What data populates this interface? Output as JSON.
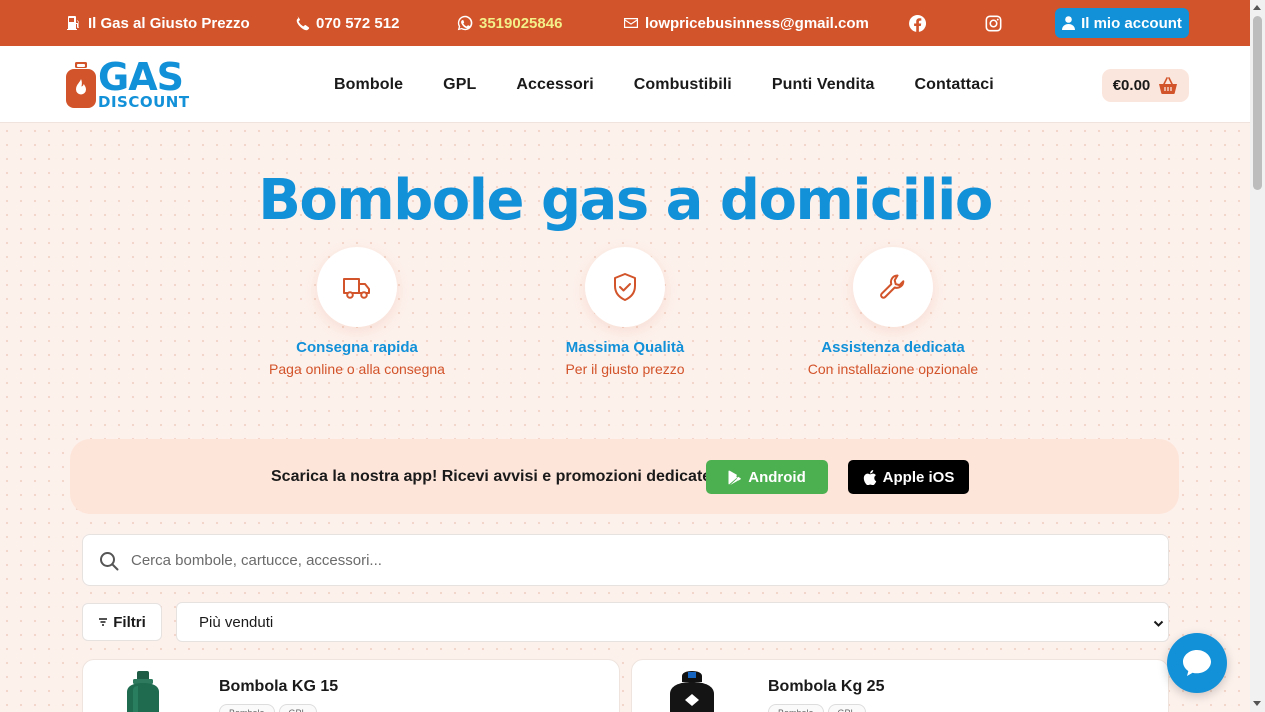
{
  "topbar": {
    "tagline": "Il Gas al Giusto Prezzo",
    "phone": "070 572 512",
    "whatsapp": "3519025846",
    "email": "lowpricebusinness@gmail.com",
    "social_icons": [
      "facebook-icon",
      "instagram-icon"
    ],
    "account_label": "Il mio account"
  },
  "logo": {
    "line1": "GAS",
    "line2": "DISCOUNT"
  },
  "nav": {
    "items": [
      "Bombole",
      "GPL",
      "Accessori",
      "Combustibili",
      "Punti Vendita",
      "Contattaci"
    ]
  },
  "cart": {
    "total": "€0.00"
  },
  "hero": {
    "title": "Bombole gas a domicilio",
    "features": [
      {
        "icon": "truck-icon",
        "title": "Consegna rapida",
        "subtitle": "Paga online o alla consegna"
      },
      {
        "icon": "shield-check-icon",
        "title": "Massima Qualità",
        "subtitle": "Per il giusto prezzo"
      },
      {
        "icon": "wrench-icon",
        "title": "Assistenza dedicata",
        "subtitle": "Con installazione opzionale"
      }
    ]
  },
  "app_banner": {
    "text": "Scarica la nostra app! Ricevi avvisi e promozioni dedicate",
    "android_label": "Android",
    "ios_label": "Apple iOS"
  },
  "search": {
    "placeholder": "Cerca bombole, cartucce, accessori...",
    "value": ""
  },
  "filters": {
    "label": "Filtri",
    "sort_selected": "Più venduti"
  },
  "products": [
    {
      "title": "Bombola KG 15",
      "tags": [
        "Bombole",
        "GPL"
      ]
    },
    {
      "title": "Bombola Kg 25",
      "tags": [
        "Bombole",
        "GPL"
      ]
    }
  ],
  "colors": {
    "brand_orange": "#d2542a",
    "brand_blue": "#1290d8",
    "whatsapp_text": "#f3f08a",
    "android_green": "#4caf50"
  }
}
